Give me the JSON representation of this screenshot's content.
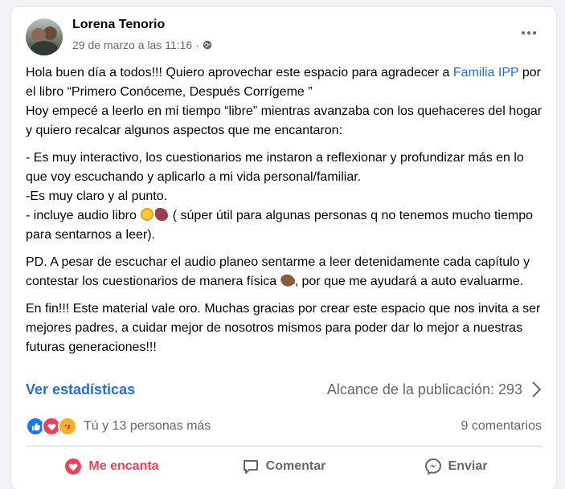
{
  "post": {
    "author": "Lorena Tenorio",
    "timestamp": "29 de marzo a las 11:16",
    "body": {
      "p1_a": "Hola buen día a todos!!! Quiero aprovechar este espacio para agradecer a ",
      "p1_link": "Familia IPP",
      "p1_b": " por el libro “Primero Conóceme, Después Corrígeme ”\nHoy empecé a leerlo en mi tiempo “libre” mientras avanzaba con los quehaceres del hogar y quiero recalcar algunos aspectos que me encantaron:",
      "p2_a": "- Es muy interactivo, los cuestionarios me instaron a reflexionar y profundizar más en lo que voy escuchando y aplicarlo a mi vida personal/familiar.\n-Es muy claro y al punto.\n- incluye audio libro ",
      "p2_b": " ( súper útil para algunas personas q no tenemos mucho tiempo para sentarnos a leer).",
      "p3_a": "PD. A pesar de escuchar el audio planeo sentarme a leer detenidamente cada capítulo y contestar los cuestionarios de manera física ",
      "p3_b": ", por que me ayudará a auto evaluarme.",
      "p4": "En fin!!! Este material vale oro. Muchas gracias por crear este espacio que nos invita a ser mejores padres, a cuidar mejor de nosotros mismos para poder dar lo mejor a nuestras futuras generaciones!!!"
    },
    "stats_link": "Ver estadísticas",
    "reach_label": "Alcance de la publicación: 293",
    "reactions_text": "Tú y 13 personas más",
    "comments_count": "9 comentarios",
    "actions": {
      "love": "Me encanta",
      "comment": "Comentar",
      "send": "Enviar"
    },
    "colors": {
      "link": "#216fdb",
      "love": "#f33e58",
      "like": "#1877f2",
      "care": "#f7b125"
    },
    "icons": [
      "more-options-icon",
      "globe-icon",
      "chevron-right-icon",
      "like-reaction-icon",
      "love-reaction-icon",
      "care-reaction-icon",
      "heart-icon",
      "comment-icon",
      "messenger-icon"
    ]
  }
}
